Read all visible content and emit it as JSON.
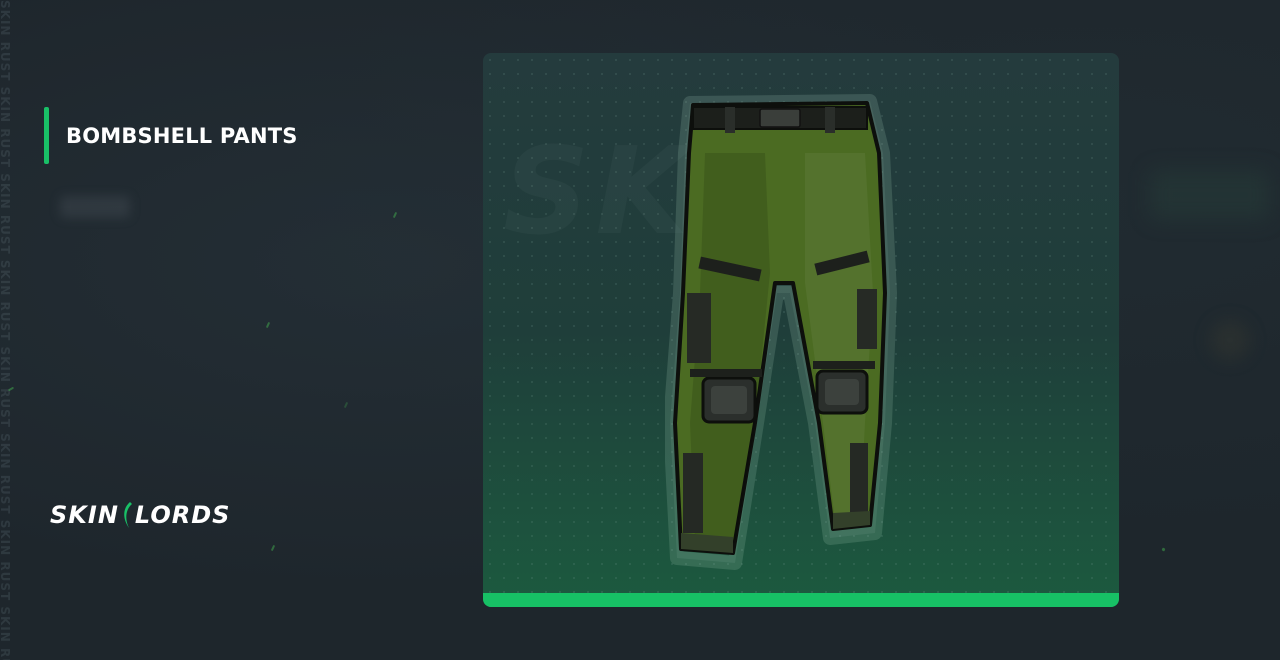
{
  "item": {
    "name": "BOMBSHELL PANTS",
    "image_icon": "green-armored-pants-image"
  },
  "brand": {
    "logo_text_left": "SKIN",
    "logo_text_right": "LORDS",
    "side_watermark": "SKIN RUST SKIN RUST SKIN RUST SKIN RUST SKIN RUST SKIN RUST SKIN RUST SKIN RUST"
  },
  "colors": {
    "accent": "#19c067",
    "background": "#1e262c",
    "card_top": "#243b3d",
    "card_bottom": "#1c5a3f",
    "pants_green": "#4a6a22"
  }
}
